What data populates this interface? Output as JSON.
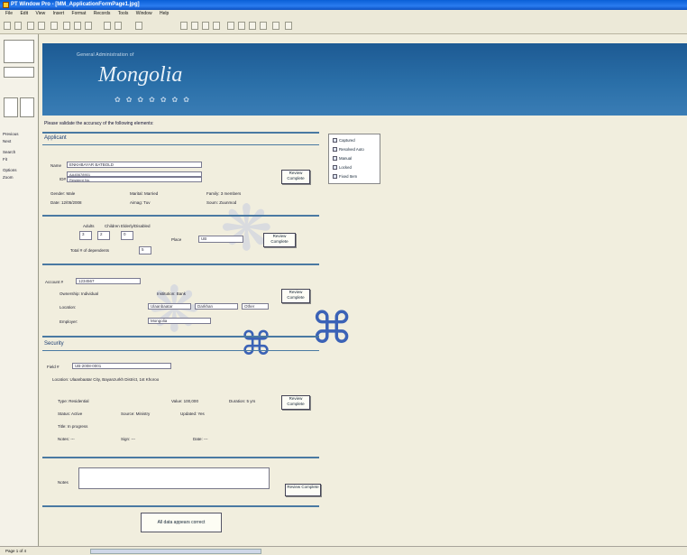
{
  "titlebar": {
    "title": "PT Window Pro - [MM_ApplicationFormPage1.jpg]"
  },
  "menu": [
    "File",
    "Edit",
    "View",
    "Insert",
    "Format",
    "Records",
    "Tools",
    "Window",
    "Help"
  ],
  "left_panel": {
    "items": [
      "Previous",
      "Next",
      "Search",
      "Fit",
      "Options",
      "Zoom"
    ]
  },
  "banner": {
    "subtitle": "General Administration of",
    "title": "Mongolia"
  },
  "prompt": "Please validate the accuracy of the following elements:",
  "legend": {
    "items": [
      "Captured",
      "Resolved Auto",
      "Manual",
      "Locked",
      "Fixed Item"
    ]
  },
  "applicant": {
    "section_title": "Applicant",
    "name_label": "Name",
    "name_value": "ENKHBAYAR BATBOLD",
    "id_label": "ID#",
    "id_line1": "AA45678901",
    "id_line2": "Resident No.",
    "row1": [
      "Gender: Male",
      "Marital: Married",
      "Family: 3 members"
    ],
    "row2": [
      "Date: 12/05/2008",
      "Aimag: Tuv",
      "Soum: Zuunmod"
    ],
    "button": "Review Complete"
  },
  "household": {
    "labels": [
      "Adults",
      "Children",
      "Elderly/Disabled"
    ],
    "values": [
      "3",
      "2",
      "0"
    ],
    "total_label": "Total # of dependents",
    "total_value": "5",
    "place_label": "Place",
    "place_value": "UB",
    "button": "Review Complete"
  },
  "account": {
    "label": "Account #",
    "value": "1234567",
    "row1": [
      "Ownership: Individual",
      "Institution: Bank"
    ],
    "row2_label": "Location:",
    "row2_opts": [
      "Ulaanbaatar",
      "Darkhan",
      "Other"
    ],
    "row3_label": "Employer:",
    "row3_value": "Mongolia",
    "button": "Review Complete"
  },
  "security": {
    "section_title": "Security",
    "field_label": "Field #",
    "field_value": "UB-2008-0001",
    "line1": "Location: Ulaanbaatar City, Bayanzurkh District, 1st Khoroo",
    "row1": [
      "Type: Residential",
      "Value: 100,000",
      "Duration: 5 yrs"
    ],
    "row2": [
      "Status: Active",
      "Source: Ministry",
      "Updated: Yes"
    ],
    "row3": [
      "Title: In progress"
    ],
    "row4": [
      "Notes: ---",
      "Sign: ---",
      "Date: ---"
    ],
    "button": "Review Complete"
  },
  "notes": {
    "label": "Notes",
    "button": "Review Complete"
  },
  "confirm_button": "All data appears correct",
  "status": {
    "text": "Page 1 of 4"
  }
}
